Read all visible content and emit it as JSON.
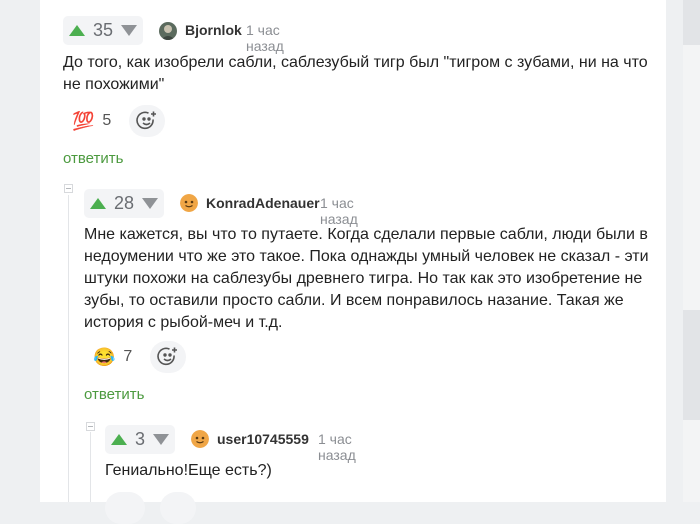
{
  "comments": [
    {
      "score": "35",
      "author": "Bjornlok",
      "time": "1 час назад",
      "text": "До того, как изобрели сабли, саблезубый тигр был \"тигром с зубами, ни на что не похожими\"",
      "reaction_emoji": "💯",
      "reaction_count": "5",
      "reply_label": "ответить"
    },
    {
      "score": "28",
      "author": "KonradAdenauer",
      "time": "1 час назад",
      "text": "Мне кажется, вы что то путаете. Когда сделали первые сабли, люди были в недоумении что же это такое. Пока однажды умный человек не сказал - эти штуки похожи на саблезубы древнего тигра. Но так как это изобретение не зубы, то оставили просто сабли. И всем понравилось назание. Такая же история с рыбой-меч и т.д.",
      "reaction_emoji": "😂",
      "reaction_count": "7",
      "reply_label": "ответить"
    },
    {
      "score": "3",
      "author": "user10745559",
      "time": "1 час назад",
      "text": "Гениально!Еще есть?)"
    }
  ]
}
